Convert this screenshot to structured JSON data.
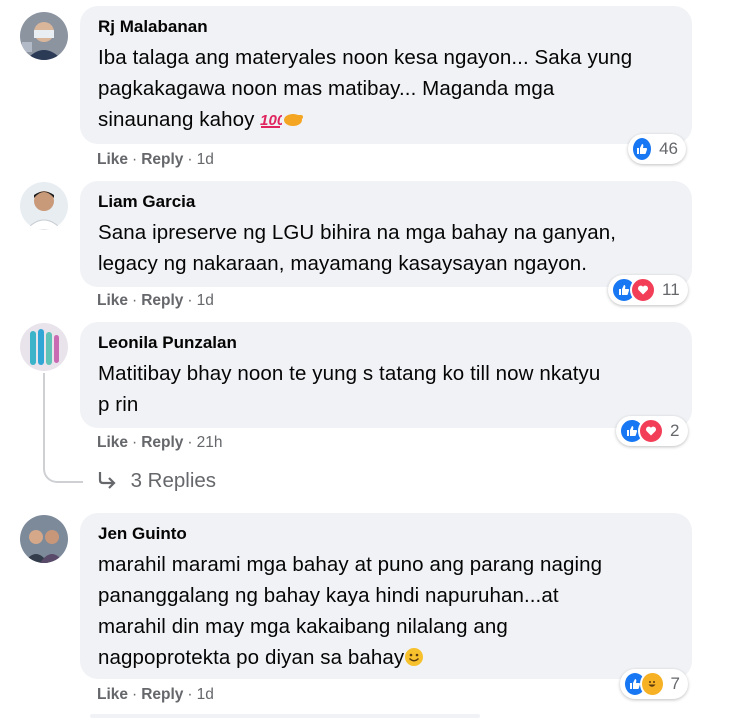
{
  "colors": {
    "like": "#1877f2",
    "love": "#f33e58",
    "haha": "#f7b125",
    "meta": "#65676b",
    "bubble": "#f0f2f5"
  },
  "comments": [
    {
      "author": "Rj Malabanan",
      "lines": [
        "Iba talaga ang materyales noon kesa ngayon... Saka yung",
        "pagkakagawa noon mas matibay... Maganda mga",
        "sinaunang kahoy"
      ],
      "emojis": [
        "hundred-points-emoji",
        "hand-emoji"
      ],
      "like": "Like",
      "reply": "Reply",
      "time": "1d",
      "reaction_icons": [
        "like-icon"
      ],
      "reaction_count": "46"
    },
    {
      "author": "Liam Garcia",
      "lines": [
        "Sana ipreserve ng LGU bihira na mga bahay na ganyan,",
        "legacy ng nakaraan, mayamang kasaysayan ngayon."
      ],
      "like": "Like",
      "reply": "Reply",
      "time": "1d",
      "reaction_icons": [
        "like-icon",
        "love-icon"
      ],
      "reaction_count": "11"
    },
    {
      "author": "Leonila Punzalan",
      "lines": [
        "Matitibay bhay noon te yung s tatang ko till now nkatyu",
        "p rin"
      ],
      "like": "Like",
      "reply": "Reply",
      "time": "21h",
      "reaction_icons": [
        "like-icon",
        "love-icon"
      ],
      "reaction_count": "2",
      "replies_label": "3 Replies"
    },
    {
      "author": "Jen Guinto",
      "lines": [
        "marahil marami mga bahay at puno ang parang naging",
        "pananggalang ng bahay kaya hindi napuruhan...at",
        "marahil din may mga kakaibang nilalang ang",
        "nagpoprotekta po diyan sa bahay"
      ],
      "emojis": [
        "smiling-face-emoji"
      ],
      "like": "Like",
      "reply": "Reply",
      "time": "1d",
      "reaction_icons": [
        "like-icon",
        "haha-icon"
      ],
      "reaction_count": "7"
    }
  ]
}
